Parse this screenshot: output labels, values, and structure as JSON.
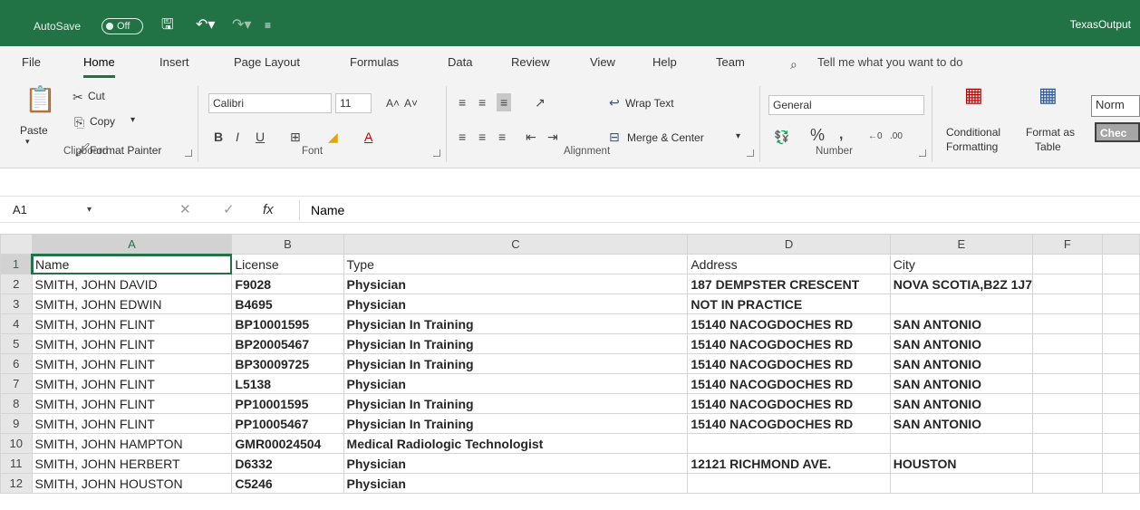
{
  "titlebar": {
    "autosave_label": "AutoSave",
    "autosave_state": "Off",
    "doc_title": "TexasOutput"
  },
  "tabs": [
    "File",
    "Home",
    "Insert",
    "Page Layout",
    "Formulas",
    "Data",
    "Review",
    "View",
    "Help",
    "Team"
  ],
  "active_tab": "Home",
  "tell_me": "Tell me what you want to do",
  "ribbon": {
    "clipboard": {
      "label": "Clipboard",
      "paste": "Paste",
      "cut": "Cut",
      "copy": "Copy",
      "format_painter": "Format Painter"
    },
    "font": {
      "label": "Font",
      "font_name": "Calibri",
      "font_size": "11"
    },
    "alignment": {
      "label": "Alignment",
      "wrap_text": "Wrap Text",
      "merge_center": "Merge & Center"
    },
    "number": {
      "label": "Number",
      "format": "General"
    },
    "styles": {
      "conditional_1": "Conditional",
      "conditional_2": "Formatting",
      "format_as_1": "Format as",
      "format_as_2": "Table",
      "style_normal": "Norm",
      "style_check": "Chec"
    }
  },
  "formula_bar": {
    "name_box": "A1",
    "formula": "Name"
  },
  "sheet": {
    "columns": [
      "A",
      "B",
      "C",
      "D",
      "E",
      "F"
    ],
    "rows": [
      {
        "n": "1",
        "cells": [
          "Name",
          "License",
          "Type",
          "Address",
          "City",
          ""
        ],
        "bold": false
      },
      {
        "n": "2",
        "cells": [
          "SMITH, JOHN DAVID",
          "F9028",
          "Physician",
          "187 DEMPSTER CRESCENT",
          "NOVA SCOTIA,B2Z 1J7",
          ""
        ],
        "bold": true
      },
      {
        "n": "3",
        "cells": [
          "SMITH, JOHN EDWIN",
          "B4695",
          "Physician",
          "NOT IN PRACTICE",
          "",
          ""
        ],
        "bold": true
      },
      {
        "n": "4",
        "cells": [
          "SMITH, JOHN FLINT",
          "BP10001595",
          "Physician In Training",
          "15140 NACOGDOCHES RD",
          "SAN ANTONIO",
          ""
        ],
        "bold": true
      },
      {
        "n": "5",
        "cells": [
          "SMITH, JOHN FLINT",
          "BP20005467",
          "Physician In Training",
          "15140 NACOGDOCHES RD",
          "SAN ANTONIO",
          ""
        ],
        "bold": true
      },
      {
        "n": "6",
        "cells": [
          "SMITH, JOHN FLINT",
          "BP30009725",
          "Physician In Training",
          "15140 NACOGDOCHES RD",
          "SAN ANTONIO",
          ""
        ],
        "bold": true
      },
      {
        "n": "7",
        "cells": [
          "SMITH, JOHN FLINT",
          "L5138",
          "Physician",
          "15140 NACOGDOCHES RD",
          "SAN ANTONIO",
          ""
        ],
        "bold": true
      },
      {
        "n": "8",
        "cells": [
          "SMITH, JOHN FLINT",
          "PP10001595",
          "Physician In Training",
          "15140 NACOGDOCHES RD",
          "SAN ANTONIO",
          ""
        ],
        "bold": true
      },
      {
        "n": "9",
        "cells": [
          "SMITH, JOHN FLINT",
          "PP10005467",
          "Physician In Training",
          "15140 NACOGDOCHES RD",
          "SAN ANTONIO",
          ""
        ],
        "bold": true
      },
      {
        "n": "10",
        "cells": [
          "SMITH, JOHN HAMPTON",
          "GMR00024504",
          "Medical Radiologic Technologist",
          "",
          "",
          ""
        ],
        "bold": true
      },
      {
        "n": "11",
        "cells": [
          "SMITH, JOHN HERBERT",
          "D6332",
          "Physician",
          "12121 RICHMOND AVE.",
          "HOUSTON",
          ""
        ],
        "bold": true
      },
      {
        "n": "12",
        "cells": [
          "SMITH, JOHN HOUSTON",
          "C5246",
          "Physician",
          "",
          "",
          ""
        ],
        "bold": true
      }
    ]
  }
}
